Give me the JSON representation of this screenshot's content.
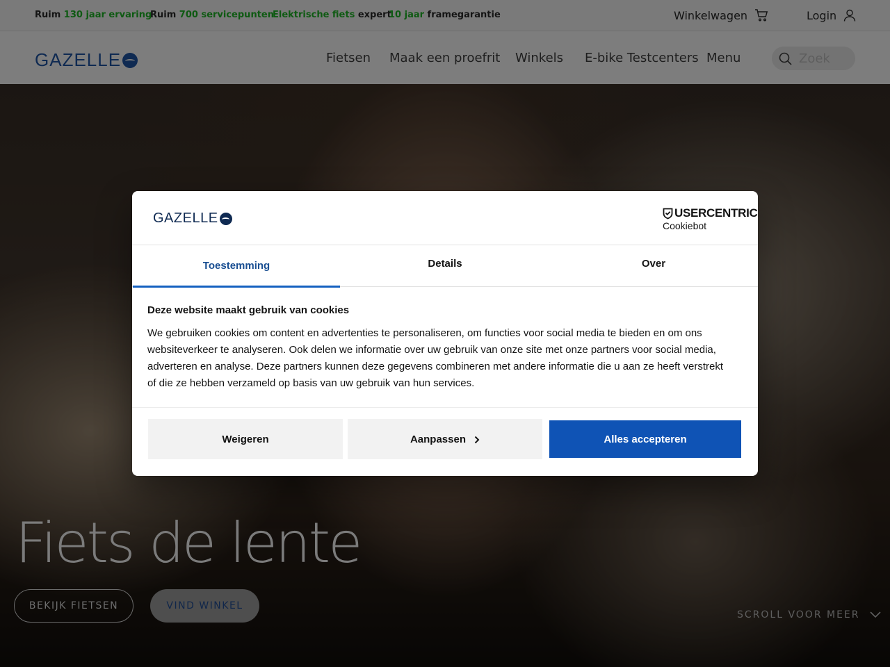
{
  "topbar": {
    "usps": [
      {
        "pre": "Ruim ",
        "hl": "130 jaar ervaring",
        "post": ""
      },
      {
        "pre": "Ruim ",
        "hl": "700 servicepunten",
        "post": ""
      },
      {
        "pre": "",
        "hl": "Elektrische fiets",
        "post": " expert"
      },
      {
        "pre": "",
        "hl": "10 jaar",
        "post": " framegarantie"
      }
    ],
    "cart_label": "Winkelwagen",
    "login_label": "Login"
  },
  "nav": {
    "logo": "GAZELLE",
    "links": [
      "Fietsen",
      "Maak een proefrit",
      "Winkels",
      "E-bike Testcenters",
      "Menu"
    ],
    "search_placeholder": "Zoek"
  },
  "hero": {
    "title": "Fiets de lente",
    "primary_button": "BEKIJK FIETSEN",
    "secondary_button": "VIND WINKEL",
    "scroll_label": "SCROLL VOOR MEER"
  },
  "cookie_dialog": {
    "logo": "GAZELLE",
    "provider_top": "USERCENTRICS",
    "provider_bottom": "Cookiebot",
    "tabs": [
      "Toestemming",
      "Details",
      "Over"
    ],
    "active_tab": "Toestemming",
    "heading": "Deze website maakt gebruik van cookies",
    "body": "We gebruiken cookies om content en advertenties te personaliseren, om functies voor social media te bieden en om ons websiteverkeer te analyseren. Ook delen we informatie over uw gebruik van onze site met onze partners voor social media, adverteren en analyse. Deze partners kunnen deze gegevens combineren met andere informatie die u aan ze heeft verstrekt of die ze hebben verzameld op basis van uw gebruik van hun services.",
    "buttons": {
      "deny": "Weigeren",
      "customize": "Aanpassen",
      "accept": "Alles accepteren"
    }
  },
  "colors": {
    "brand_navy": "#0f2a52",
    "accept_blue": "#0f53b5",
    "usp_green": "#0e5a12"
  }
}
